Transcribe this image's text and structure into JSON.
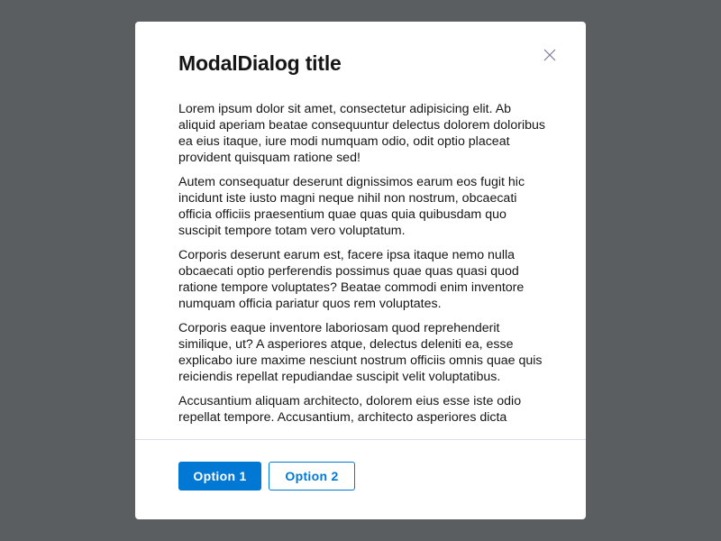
{
  "dialog": {
    "title": "ModalDialog title",
    "close_icon": "close-x-icon",
    "paragraphs": [
      "Lorem ipsum dolor sit amet, consectetur adipisicing elit. Ab aliquid aperiam beatae consequuntur delectus dolorem doloribus ea eius itaque, iure modi numquam odio, odit optio placeat provident quisquam ratione sed!",
      "Autem consequatur deserunt dignissimos earum eos fugit hic incidunt iste iusto magni neque nihil non nostrum, obcaecati officia officiis praesentium quae quas quia quibusdam quo suscipit tempore totam vero voluptatum.",
      "Corporis deserunt earum est, facere ipsa itaque nemo nulla obcaecati optio perferendis possimus quae quas quasi quod ratione tempore voluptates? Beatae commodi enim inventore numquam officia pariatur quos rem voluptates.",
      "Corporis eaque inventore laboriosam quod reprehenderit similique, ut? A asperiores atque, delectus deleniti ea, esse explicabo iure maxime nesciunt nostrum officiis omnis quae quis reiciendis repellat repudiandae suscipit velit voluptatibus.",
      "Accusantium aliquam architecto, dolorem eius esse iste odio repellat tempore. Accusantium, architecto asperiores dicta"
    ],
    "buttons": {
      "option1": "Option 1",
      "option2": "Option 2"
    },
    "colors": {
      "accent": "#0078d4",
      "backdrop": "#5b5e61"
    }
  }
}
